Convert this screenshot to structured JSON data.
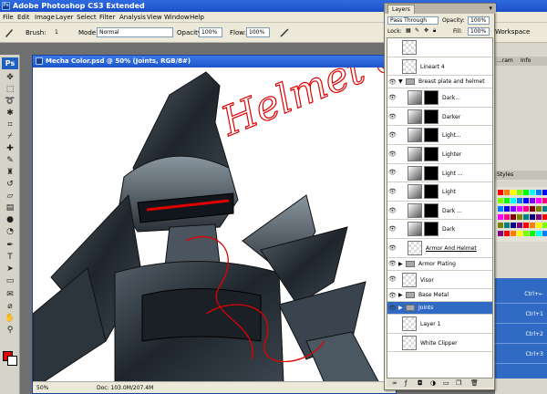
{
  "app": {
    "title": "Adobe Photoshop CS3 Extended"
  },
  "menu": [
    "File",
    "Edit",
    "Image",
    "Layer",
    "Select",
    "Filter",
    "Analysis",
    "View",
    "Window",
    "Help"
  ],
  "options": {
    "brush_label": "Brush:",
    "brush_size": "1",
    "mode_label": "Mode:",
    "mode_value": "Normal",
    "opacity_label": "Opacity:",
    "opacity_value": "100%",
    "flow_label": "Flow:",
    "flow_value": "100%",
    "workspace_label": "Workspace"
  },
  "tools": {
    "badge": "Ps"
  },
  "document": {
    "title": "Mecha Color.psd @ 50% (Joints, RGB/8#)",
    "zoom": "50%",
    "doc_size": "Doc: 103.0M/207.4M",
    "annotation": "Helmet & Breast Plate Shading"
  },
  "layers_panel": {
    "tab": "Layers",
    "blend_mode": "Pass Through",
    "opacity_label": "Opacity:",
    "opacity_value": "100%",
    "lock_label": "Lock:",
    "fill_label": "Fill:",
    "fill_value": "100%",
    "layers": [
      {
        "name": "",
        "kind": "pixel",
        "indent": false,
        "selected": false,
        "eye": false
      },
      {
        "name": "Lineart 4",
        "kind": "pixel",
        "indent": false,
        "selected": false,
        "eye": false
      },
      {
        "name": "Breast plate and helmet",
        "kind": "group-open",
        "indent": false,
        "selected": false,
        "eye": true
      },
      {
        "name": "Dark...",
        "kind": "adjust",
        "indent": true,
        "selected": false,
        "eye": true
      },
      {
        "name": "Darker",
        "kind": "adjust",
        "indent": true,
        "selected": false,
        "eye": true
      },
      {
        "name": "Light...",
        "kind": "adjust",
        "indent": true,
        "selected": false,
        "eye": true
      },
      {
        "name": "Lighter",
        "kind": "adjust",
        "indent": true,
        "selected": false,
        "eye": true
      },
      {
        "name": "Light ...",
        "kind": "adjust",
        "indent": true,
        "selected": false,
        "eye": true
      },
      {
        "name": "Light",
        "kind": "adjust",
        "indent": true,
        "selected": false,
        "eye": true
      },
      {
        "name": "Dark ...",
        "kind": "adjust",
        "indent": true,
        "selected": false,
        "eye": true
      },
      {
        "name": "Dark",
        "kind": "adjust",
        "indent": true,
        "selected": false,
        "eye": true
      },
      {
        "name": "Armor And Helmet",
        "kind": "pixel-underline",
        "indent": true,
        "selected": false,
        "eye": true
      },
      {
        "name": "Armor Plating",
        "kind": "group",
        "indent": false,
        "selected": false,
        "eye": true
      },
      {
        "name": "Visor",
        "kind": "pixel",
        "indent": false,
        "selected": false,
        "eye": true
      },
      {
        "name": "Base Metal",
        "kind": "group",
        "indent": false,
        "selected": false,
        "eye": true
      },
      {
        "name": "Joints",
        "kind": "group",
        "indent": false,
        "selected": true,
        "eye": true
      },
      {
        "name": "Layer 1",
        "kind": "pixel",
        "indent": false,
        "selected": false,
        "eye": false
      },
      {
        "name": "White Clipper",
        "kind": "pixel",
        "indent": false,
        "selected": false,
        "eye": false
      }
    ]
  },
  "dock": {
    "tabs": [
      "...ram",
      "Info"
    ],
    "styles_tab": "Styles",
    "actions": [
      "Ctrl+←",
      "Ctrl+1",
      "Ctrl+2",
      "Ctrl+3"
    ]
  },
  "colors": {
    "accent": "#316ac5",
    "foreground": "#e00000",
    "background": "#ffffff",
    "annotation": "#e00000"
  }
}
